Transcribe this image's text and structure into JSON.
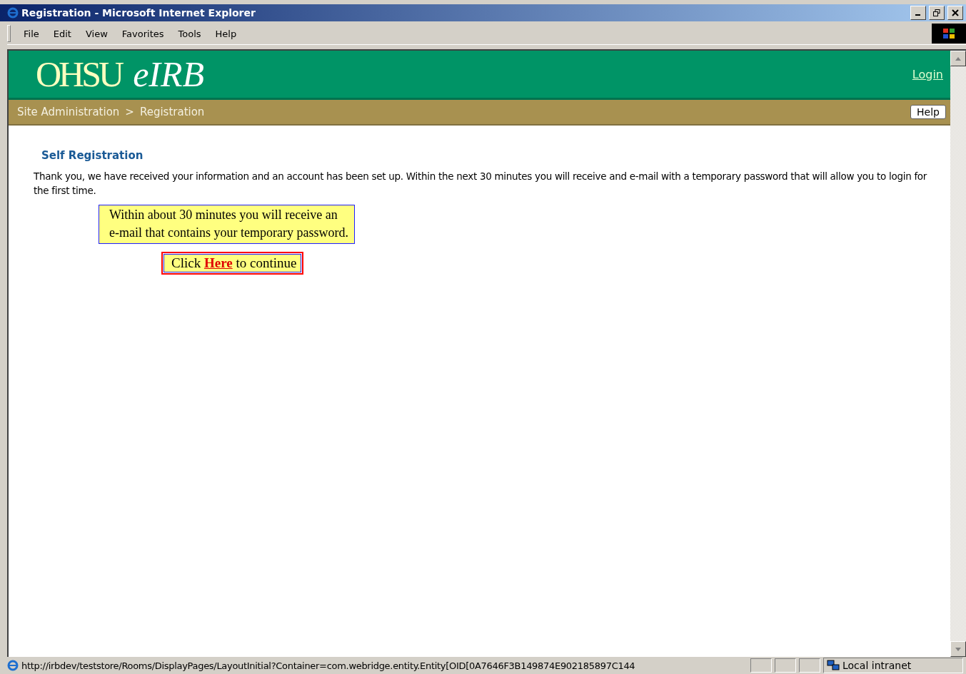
{
  "window": {
    "title": "Registration - Microsoft Internet Explorer"
  },
  "menu": [
    "File",
    "Edit",
    "View",
    "Favorites",
    "Tools",
    "Help"
  ],
  "header": {
    "logo_main": "OHSU",
    "logo_accent": "eIRB",
    "login": "Login"
  },
  "breadcrumb": {
    "items": [
      "Site Administration",
      "Registration"
    ],
    "separator": ">",
    "help": "Help"
  },
  "content": {
    "heading": "Self Registration",
    "message": "Thank you, we have received your information and an account has been set up. Within the next 30 minutes you will receive and e-mail with a temporary password that will allow you to login for the first time."
  },
  "callouts": [
    {
      "kind": "note",
      "lines": [
        "Within about 30 minutes you will receive an",
        "e-mail that contains your temporary password."
      ]
    },
    {
      "kind": "link",
      "before": "Click",
      "link": "Here",
      "after": "to continue"
    }
  ],
  "status_bar": {
    "url": "http://irbdev/teststore/Rooms/DisplayPages/LayoutInitial?Container=com.webridge.entity.Entity[OID[0A7646F3B149874E902185897C144",
    "zone": "Local intranet"
  }
}
